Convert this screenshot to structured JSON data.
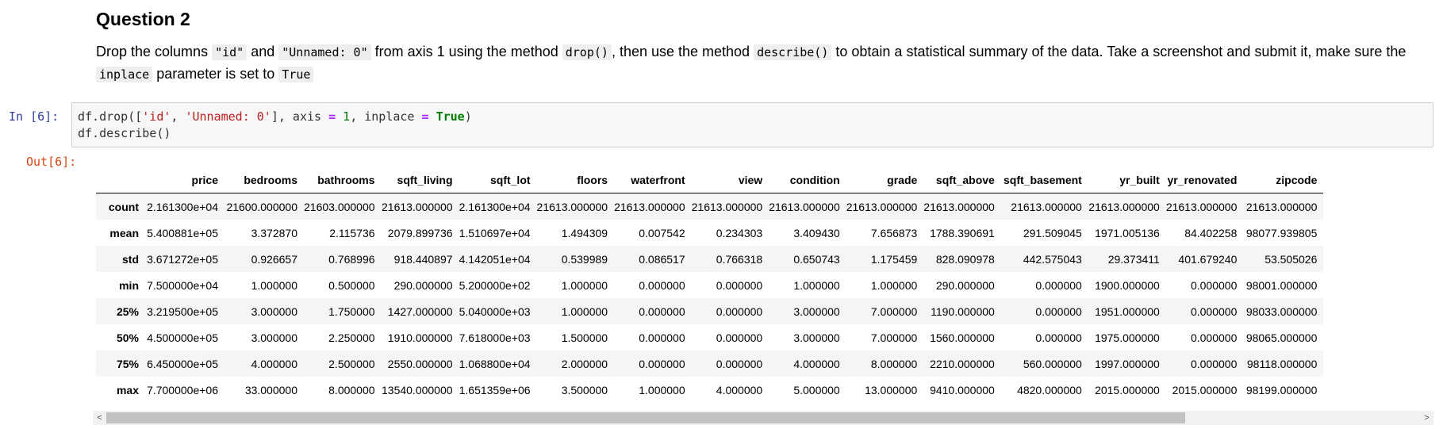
{
  "markdown": {
    "title": "Question 2",
    "text_1": "Drop the columns ",
    "code_1": "\"id\"",
    "text_2": " and ",
    "code_2": "\"Unnamed: 0\"",
    "text_3": " from axis 1 using the method ",
    "code_3": "drop()",
    "text_4": ", then use the method ",
    "code_4": "describe()",
    "text_5": " to obtain a statistical summary of the data. Take a screenshot and submit it, make sure the ",
    "code_5": "inplace",
    "text_6": " parameter is set to ",
    "code_6": "True"
  },
  "cell": {
    "in_prompt": "In [6]:",
    "out_prompt": "Out[6]:",
    "code": {
      "a": "df.drop([",
      "s1": "'id'",
      "b": ", ",
      "s2": "'Unnamed: 0'",
      "c": "], axis ",
      "op1": "=",
      "d": " ",
      "n1": "1",
      "e": ", inplace ",
      "op2": "=",
      "f": " ",
      "kw": "True",
      "g": ")",
      "line2": "df.describe()"
    }
  },
  "table": {
    "columns": [
      "price",
      "bedrooms",
      "bathrooms",
      "sqft_living",
      "sqft_lot",
      "floors",
      "waterfront",
      "view",
      "condition",
      "grade",
      "sqft_above",
      "sqft_basement",
      "yr_built",
      "yr_renovated",
      "zipcode"
    ],
    "rows": [
      {
        "label": "count",
        "values": [
          "2.161300e+04",
          "21600.000000",
          "21603.000000",
          "21613.000000",
          "2.161300e+04",
          "21613.000000",
          "21613.000000",
          "21613.000000",
          "21613.000000",
          "21613.000000",
          "21613.000000",
          "21613.000000",
          "21613.000000",
          "21613.000000",
          "21613.000000"
        ]
      },
      {
        "label": "mean",
        "values": [
          "5.400881e+05",
          "3.372870",
          "2.115736",
          "2079.899736",
          "1.510697e+04",
          "1.494309",
          "0.007542",
          "0.234303",
          "3.409430",
          "7.656873",
          "1788.390691",
          "291.509045",
          "1971.005136",
          "84.402258",
          "98077.939805"
        ]
      },
      {
        "label": "std",
        "values": [
          "3.671272e+05",
          "0.926657",
          "0.768996",
          "918.440897",
          "4.142051e+04",
          "0.539989",
          "0.086517",
          "0.766318",
          "0.650743",
          "1.175459",
          "828.090978",
          "442.575043",
          "29.373411",
          "401.679240",
          "53.505026"
        ]
      },
      {
        "label": "min",
        "values": [
          "7.500000e+04",
          "1.000000",
          "0.500000",
          "290.000000",
          "5.200000e+02",
          "1.000000",
          "0.000000",
          "0.000000",
          "1.000000",
          "1.000000",
          "290.000000",
          "0.000000",
          "1900.000000",
          "0.000000",
          "98001.000000"
        ]
      },
      {
        "label": "25%",
        "values": [
          "3.219500e+05",
          "3.000000",
          "1.750000",
          "1427.000000",
          "5.040000e+03",
          "1.000000",
          "0.000000",
          "0.000000",
          "3.000000",
          "7.000000",
          "1190.000000",
          "0.000000",
          "1951.000000",
          "0.000000",
          "98033.000000"
        ]
      },
      {
        "label": "50%",
        "values": [
          "4.500000e+05",
          "3.000000",
          "2.250000",
          "1910.000000",
          "7.618000e+03",
          "1.500000",
          "0.000000",
          "0.000000",
          "3.000000",
          "7.000000",
          "1560.000000",
          "0.000000",
          "1975.000000",
          "0.000000",
          "98065.000000"
        ]
      },
      {
        "label": "75%",
        "values": [
          "6.450000e+05",
          "4.000000",
          "2.500000",
          "2550.000000",
          "1.068800e+04",
          "2.000000",
          "0.000000",
          "0.000000",
          "4.000000",
          "8.000000",
          "2210.000000",
          "560.000000",
          "1997.000000",
          "0.000000",
          "98118.000000"
        ]
      },
      {
        "label": "max",
        "values": [
          "7.700000e+06",
          "33.000000",
          "8.000000",
          "13540.000000",
          "1.651359e+06",
          "3.500000",
          "1.000000",
          "4.000000",
          "5.000000",
          "13.000000",
          "9410.000000",
          "4820.000000",
          "2015.000000",
          "2015.000000",
          "98199.000000"
        ]
      }
    ]
  },
  "scrollbar": {
    "left_icon": "arrow-left-icon",
    "right_icon": "arrow-right-icon",
    "left_glyph": "<",
    "right_glyph": ">"
  }
}
